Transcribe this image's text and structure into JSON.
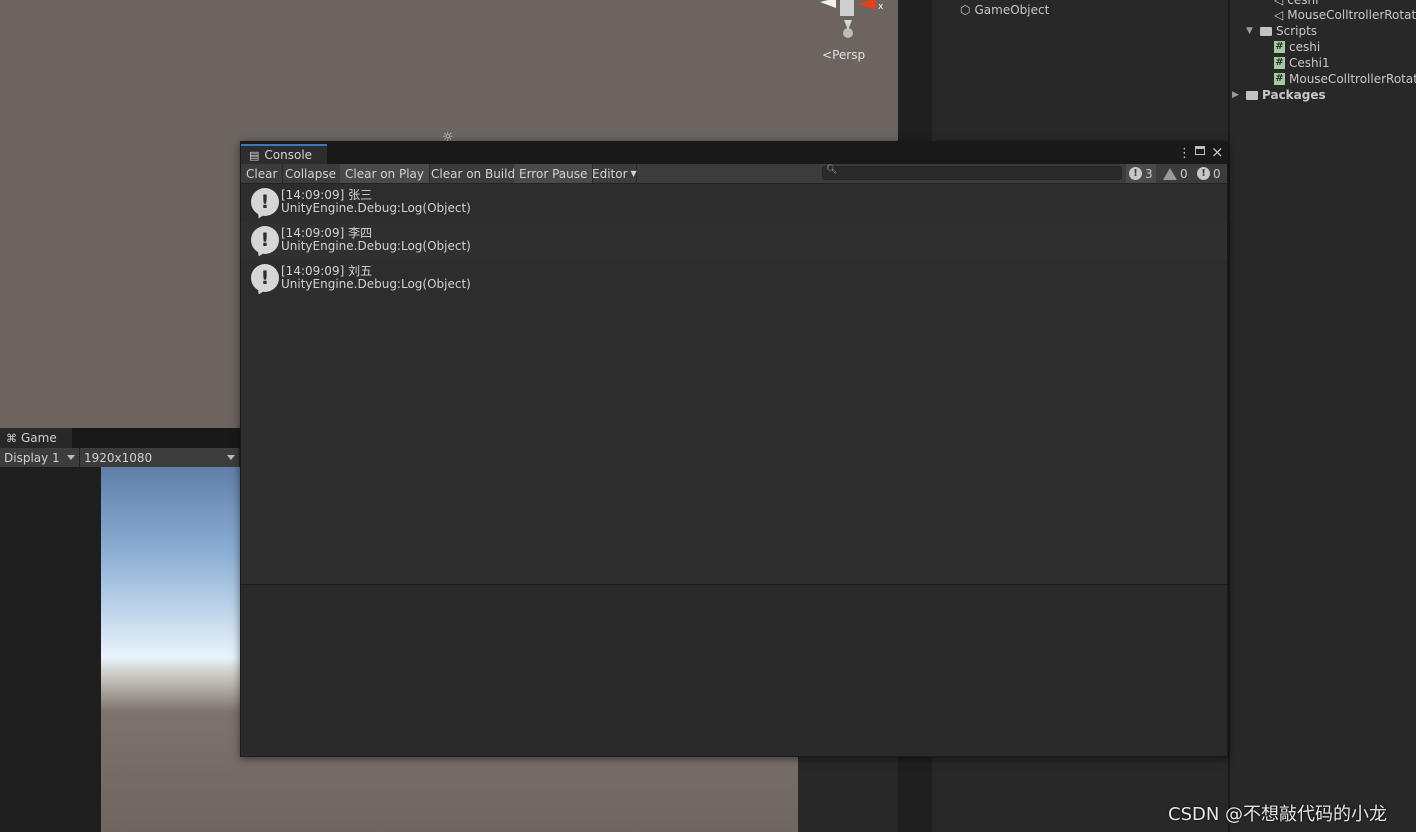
{
  "scene": {
    "persp_label": "Persp",
    "gizmo_axis": "x"
  },
  "hierarchy": {
    "items": [
      "GameObject"
    ]
  },
  "project": {
    "rows": [
      {
        "label": "ceshi",
        "icon": "unity-icon"
      },
      {
        "label": "MouseColltrollerRotate",
        "icon": "unity-icon"
      },
      {
        "label": "Scripts",
        "icon": "folder-icon"
      },
      {
        "label": "ceshi",
        "icon": "csharp-icon"
      },
      {
        "label": "Ceshi1",
        "icon": "csharp-icon"
      },
      {
        "label": "MouseColltrollerRotati",
        "icon": "csharp-icon"
      },
      {
        "label": "Packages",
        "icon": "folder-icon"
      }
    ]
  },
  "game": {
    "tab_label": "Game",
    "display_value": "Display 1",
    "resolution_value": "1920x1080"
  },
  "console": {
    "tab_label": "Console",
    "toolbar": {
      "clear": "Clear",
      "collapse": "Collapse",
      "clear_on_play": "Clear on Play",
      "clear_on_build": "Clear on Build",
      "error_pause": "Error Pause",
      "editor": "Editor"
    },
    "search_value": "",
    "counts": {
      "log": "3",
      "warning": "0",
      "error": "0"
    },
    "logs": [
      {
        "line1": "[14:09:09] 张三",
        "line2": "UnityEngine.Debug:Log(Object)"
      },
      {
        "line1": "[14:09:09] 李四",
        "line2": "UnityEngine.Debug:Log(Object)"
      },
      {
        "line1": "[14:09:09] 刘五",
        "line2": "UnityEngine.Debug:Log(Object)"
      }
    ]
  },
  "watermark": "CSDN @不想敲代码的小龙"
}
